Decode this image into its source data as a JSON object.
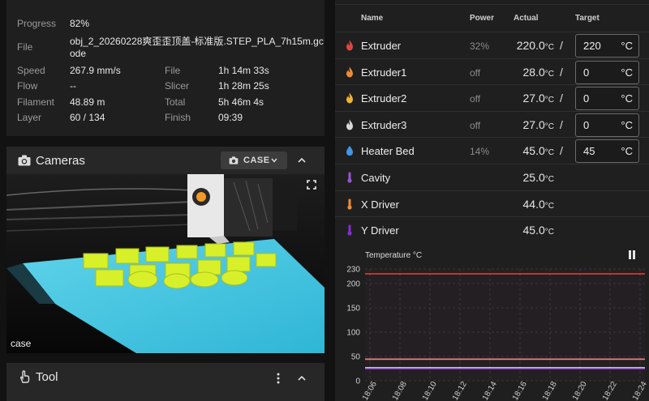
{
  "status": {
    "progress_label": "Progress",
    "progress_value": "82%",
    "file_label": "File",
    "file_value_line1": "obj_2_20260228爽歪歪顶盖-标准版.STEP_PLA_7h15m.gc",
    "file_value_line2": "ode",
    "speed_label": "Speed",
    "speed_value": "267.9 mm/s",
    "flow_label": "Flow",
    "flow_value": "--",
    "filament_label": "Filament",
    "filament_value": "48.89 m",
    "layer_label": "Layer",
    "layer_value": "60 / 134",
    "file_time_label": "File",
    "file_time_value": "1h 14m 33s",
    "slicer_label": "Slicer",
    "slicer_value": "1h 28m 25s",
    "total_label": "Total",
    "total_value": "5h 46m 4s",
    "finish_label": "Finish",
    "finish_value": "09:39"
  },
  "cameras": {
    "title": "Cameras",
    "selector_label": "CASE",
    "caption": "case"
  },
  "tool": {
    "title": "Tool"
  },
  "temps": {
    "headers": {
      "name": "Name",
      "power": "Power",
      "actual": "Actual",
      "target": "Target"
    },
    "unit": "°C",
    "rows": [
      {
        "name": "Extruder",
        "power": "32%",
        "actual": "220.0",
        "target": "220",
        "icon": "fire-icon",
        "color": "#e0463f"
      },
      {
        "name": "Extruder1",
        "power": "off",
        "actual": "28.0",
        "target": "0",
        "icon": "fire-icon",
        "color": "#f28b30"
      },
      {
        "name": "Extruder2",
        "power": "off",
        "actual": "27.0",
        "target": "0",
        "icon": "fire-icon",
        "color": "#f2b233"
      },
      {
        "name": "Extruder3",
        "power": "off",
        "actual": "27.0",
        "target": "0",
        "icon": "fire-icon",
        "color": "#d9d9d9"
      },
      {
        "name": "Heater Bed",
        "power": "14%",
        "actual": "45.0",
        "target": "45",
        "icon": "heater-bed-icon",
        "color": "#3f95e8"
      },
      {
        "name": "Cavity",
        "actual": "25.0",
        "icon": "thermometer-icon",
        "color": "#9a54d8"
      },
      {
        "name": "X Driver",
        "actual": "44.0",
        "icon": "thermometer-icon",
        "color": "#f28b30"
      },
      {
        "name": "Y Driver",
        "actual": "45.0",
        "icon": "thermometer-icon",
        "color": "#8c2ad8"
      }
    ]
  },
  "chart_data": {
    "type": "line",
    "title": "Temperature °C",
    "ylabel": "",
    "ylim": [
      0,
      230
    ],
    "yticks": [
      0,
      50,
      100,
      150,
      200,
      230
    ],
    "x": [
      "18:06",
      "18:08",
      "18:10",
      "18:12",
      "18:14",
      "18:16",
      "18:18",
      "18:20",
      "18:22",
      "18:24"
    ],
    "series": [
      {
        "color": "#e0463f",
        "values": [
          220,
          220,
          220,
          220,
          220,
          220,
          220,
          220,
          220,
          220
        ]
      },
      {
        "color": "#3f95e8",
        "values": [
          45,
          45,
          45,
          45,
          45,
          45,
          45,
          45,
          45,
          45
        ]
      },
      {
        "color": "#8c2ad8",
        "values": [
          45,
          45,
          45,
          45,
          45,
          45,
          45,
          45,
          45,
          45
        ]
      },
      {
        "color": "#f28b30",
        "values": [
          44,
          44,
          44,
          44,
          44,
          44,
          44,
          44,
          44,
          44
        ]
      },
      {
        "color": "#d9d9d9",
        "values": [
          27,
          27,
          27,
          27,
          27,
          27,
          27,
          27,
          27,
          27
        ]
      },
      {
        "color": "#9a54d8",
        "values": [
          25,
          25,
          25,
          25,
          25,
          25,
          25,
          25,
          25,
          25
        ]
      }
    ]
  }
}
